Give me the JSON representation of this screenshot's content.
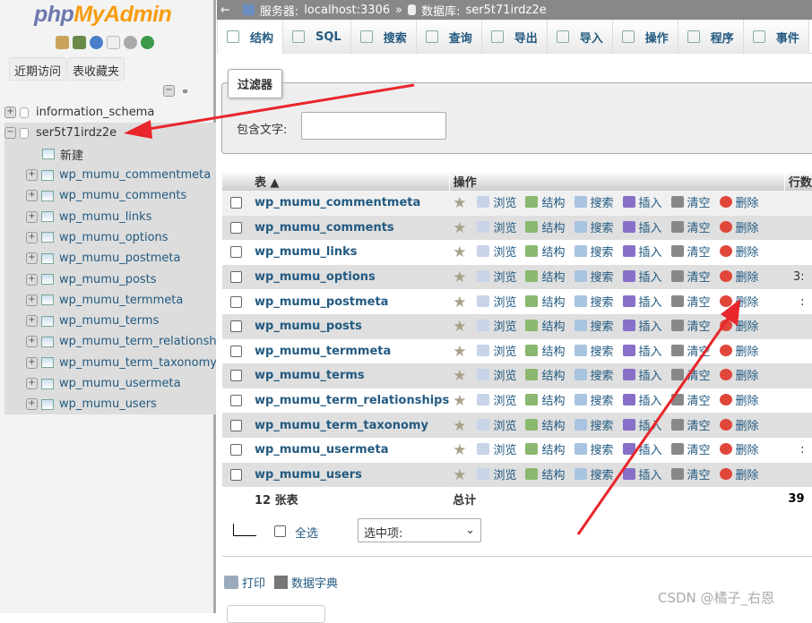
{
  "logo": {
    "php": "php",
    "my": "MyAdmin"
  },
  "sidebar": {
    "recent": "近期访问",
    "favorites": "表收藏夹",
    "databases": [
      {
        "name": "information_schema",
        "expanded": false
      },
      {
        "name": "ser5t71irdz2e",
        "expanded": true
      }
    ],
    "new_label": "新建",
    "tables": [
      "wp_mumu_commentmeta",
      "wp_mumu_comments",
      "wp_mumu_links",
      "wp_mumu_options",
      "wp_mumu_postmeta",
      "wp_mumu_posts",
      "wp_mumu_termmeta",
      "wp_mumu_terms",
      "wp_mumu_term_relationships",
      "wp_mumu_term_taxonomy",
      "wp_mumu_usermeta",
      "wp_mumu_users"
    ]
  },
  "breadcrumb": {
    "back": "←",
    "server_label": "服务器:",
    "server": "localhost:3306",
    "sep": "»",
    "db_label": "数据库:",
    "db": "ser5t71irdz2e"
  },
  "tabs": [
    "结构",
    "SQL",
    "搜索",
    "查询",
    "导出",
    "导入",
    "操作",
    "程序",
    "事件"
  ],
  "filter": {
    "legend": "过滤器",
    "label": "包含文字:",
    "value": ""
  },
  "table": {
    "headers": {
      "table": "表 ▲",
      "actions": "操作",
      "rows": "行数"
    },
    "actions": [
      "浏览",
      "结构",
      "搜索",
      "插入",
      "清空",
      "删除"
    ],
    "rows": [
      {
        "name": "wp_mumu_commentmeta",
        "count": ""
      },
      {
        "name": "wp_mumu_comments",
        "count": ""
      },
      {
        "name": "wp_mumu_links",
        "count": ""
      },
      {
        "name": "wp_mumu_options",
        "count": "3:"
      },
      {
        "name": "wp_mumu_postmeta",
        "count": ":"
      },
      {
        "name": "wp_mumu_posts",
        "count": ""
      },
      {
        "name": "wp_mumu_termmeta",
        "count": ""
      },
      {
        "name": "wp_mumu_terms",
        "count": ""
      },
      {
        "name": "wp_mumu_term_relationships",
        "count": ""
      },
      {
        "name": "wp_mumu_term_taxonomy",
        "count": ""
      },
      {
        "name": "wp_mumu_usermeta",
        "count": ":"
      },
      {
        "name": "wp_mumu_users",
        "count": ""
      }
    ],
    "footer": {
      "count": "12 张表",
      "total_label": "总计",
      "total": "39"
    }
  },
  "bulk": {
    "select_all": "全选",
    "select_placeholder": "选中项:"
  },
  "links": {
    "print": "打印",
    "dictionary": "数据字典"
  },
  "watermark": "CSDN @橘子_右恩",
  "colors": {
    "link": "#235a81",
    "annotation_arrow": "#e8262b",
    "delete": "#e0463a"
  }
}
